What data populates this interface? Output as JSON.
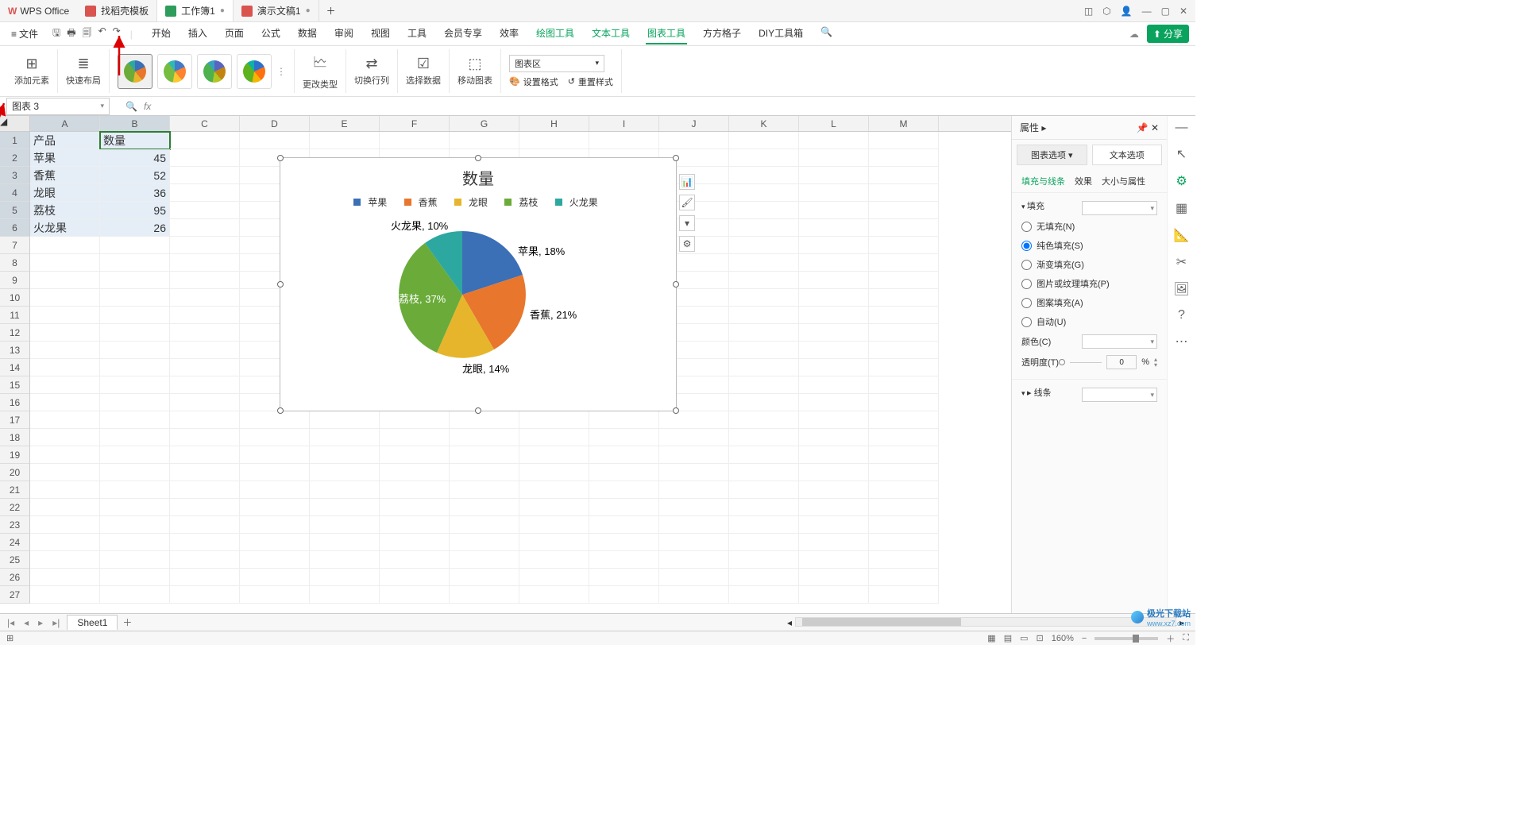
{
  "app_name": "WPS Office",
  "title_tabs": [
    {
      "label": "找稻壳模板",
      "color": "#d9534f",
      "active": false
    },
    {
      "label": "工作簿1",
      "color": "#2e9c5b",
      "active": true
    },
    {
      "label": "演示文稿1",
      "color": "#d9534f",
      "active": false
    }
  ],
  "file_menu": "文件",
  "menus": [
    "开始",
    "插入",
    "页面",
    "公式",
    "数据",
    "审阅",
    "视图",
    "工具",
    "会员专享",
    "效率"
  ],
  "menus_green": [
    "绘图工具",
    "文本工具",
    "图表工具",
    "方方格子",
    "DIY工具箱"
  ],
  "active_menu": "图表工具",
  "share_label": "分享",
  "ribbon": {
    "add_element": "添加元素",
    "quick_layout": "快速布局",
    "change_type": "更改类型",
    "switch_rc": "切换行列",
    "select_data": "选择数据",
    "move_chart": "移动图表",
    "chart_area_label": "图表区",
    "set_format": "设置格式",
    "reset_style": "重置样式"
  },
  "namebox": "图表 3",
  "fx_label": "fx",
  "columns": [
    "A",
    "B",
    "C",
    "D",
    "E",
    "F",
    "G",
    "H",
    "I",
    "J",
    "K",
    "L",
    "M"
  ],
  "table": {
    "headers": [
      "产品",
      "数量"
    ],
    "rows": [
      {
        "product": "苹果",
        "qty": 45
      },
      {
        "product": "香蕉",
        "qty": 52
      },
      {
        "product": "龙眼",
        "qty": 36
      },
      {
        "product": "荔枝",
        "qty": 95
      },
      {
        "product": "火龙果",
        "qty": 26
      }
    ]
  },
  "chart_data": {
    "type": "pie",
    "title": "数量",
    "categories": [
      "苹果",
      "香蕉",
      "龙眼",
      "荔枝",
      "火龙果"
    ],
    "values": [
      45,
      52,
      36,
      95,
      26
    ],
    "percent_labels": [
      "苹果, 18%",
      "香蕉, 21%",
      "龙眼, 14%",
      "荔枝, 37%",
      "火龙果, 10%"
    ],
    "colors": [
      "#3b6fb6",
      "#e8762c",
      "#e6b52c",
      "#6aab3a",
      "#2ca8a0"
    ]
  },
  "side_panel": {
    "title": "属性",
    "tab_chart": "图表选项",
    "tab_text": "文本选项",
    "subtabs": [
      "填充与线条",
      "效果",
      "大小与属性"
    ],
    "active_subtab": "填充与线条",
    "section_fill": "填充",
    "radios": [
      "无填充(N)",
      "纯色填充(S)",
      "渐变填充(G)",
      "图片或纹理填充(P)",
      "图案填充(A)",
      "自动(U)"
    ],
    "selected_radio": 1,
    "color_label": "颜色(C)",
    "opacity_label": "透明度(T)",
    "opacity_value": "0",
    "opacity_unit": "%",
    "section_line": "线条"
  },
  "sheet_tab": "Sheet1",
  "zoom": "160%",
  "watermark": {
    "name": "极光下载站",
    "url": "www.xz7.com"
  }
}
